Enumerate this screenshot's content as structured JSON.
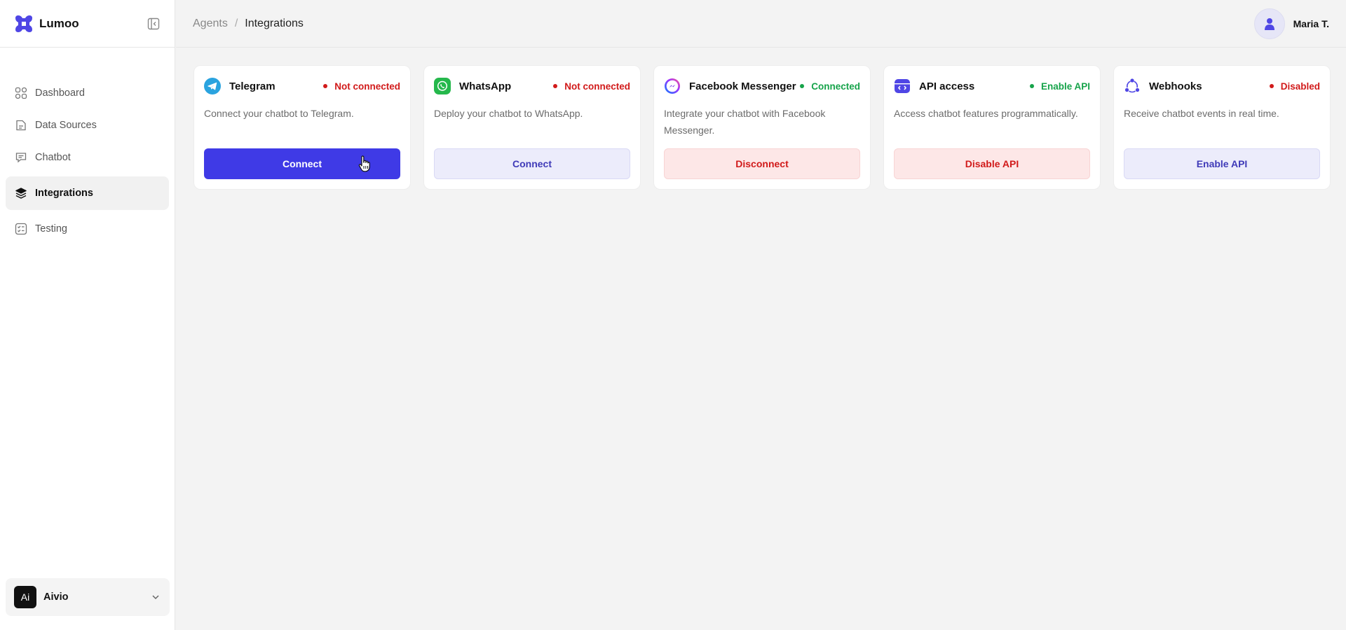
{
  "app": {
    "name": "Lumoo",
    "brand_color": "#4f46e5"
  },
  "sidebar": {
    "items": [
      {
        "label": "Dashboard",
        "icon": "dashboard-grid-icon"
      },
      {
        "label": "Data Sources",
        "icon": "document-icon"
      },
      {
        "label": "Chatbot",
        "icon": "chat-bubble-icon"
      },
      {
        "label": "Integrations",
        "icon": "layers-icon",
        "active": true
      },
      {
        "label": "Testing",
        "icon": "checklist-icon"
      }
    ],
    "workspace": {
      "badge": "Ai",
      "name": "Aivio"
    }
  },
  "header": {
    "breadcrumb": {
      "parent": "Agents",
      "separator": "/",
      "current": "Integrations"
    },
    "user": {
      "name": "Maria T."
    }
  },
  "cards": [
    {
      "title": "Telegram",
      "status": "Not connected",
      "status_color": "#d11a1a",
      "description": "Connect your chatbot to Telegram.",
      "button": "Connect",
      "icon": "telegram-icon"
    },
    {
      "title": "WhatsApp",
      "status": "Not connected",
      "status_color": "#d11a1a",
      "description": "Deploy your chatbot to WhatsApp.",
      "button": "Connect",
      "icon": "whatsapp-icon"
    },
    {
      "title": "Facebook Messenger",
      "status": "Connected",
      "status_color": "#16a34a",
      "description": "Integrate your chatbot with Facebook Messenger.",
      "button": "Disconnect",
      "icon": "messenger-icon"
    },
    {
      "title": "API access",
      "status": "Enable API",
      "status_color": "#16a34a",
      "description": "Access chatbot features programmatically.",
      "button": "Disable API",
      "icon": "api-icon"
    },
    {
      "title": "Webhooks",
      "status": "Disabled",
      "status_color": "#d11a1a",
      "description": "Receive chatbot events in real time.",
      "button": "Enable API",
      "icon": "webhooks-icon"
    }
  ]
}
